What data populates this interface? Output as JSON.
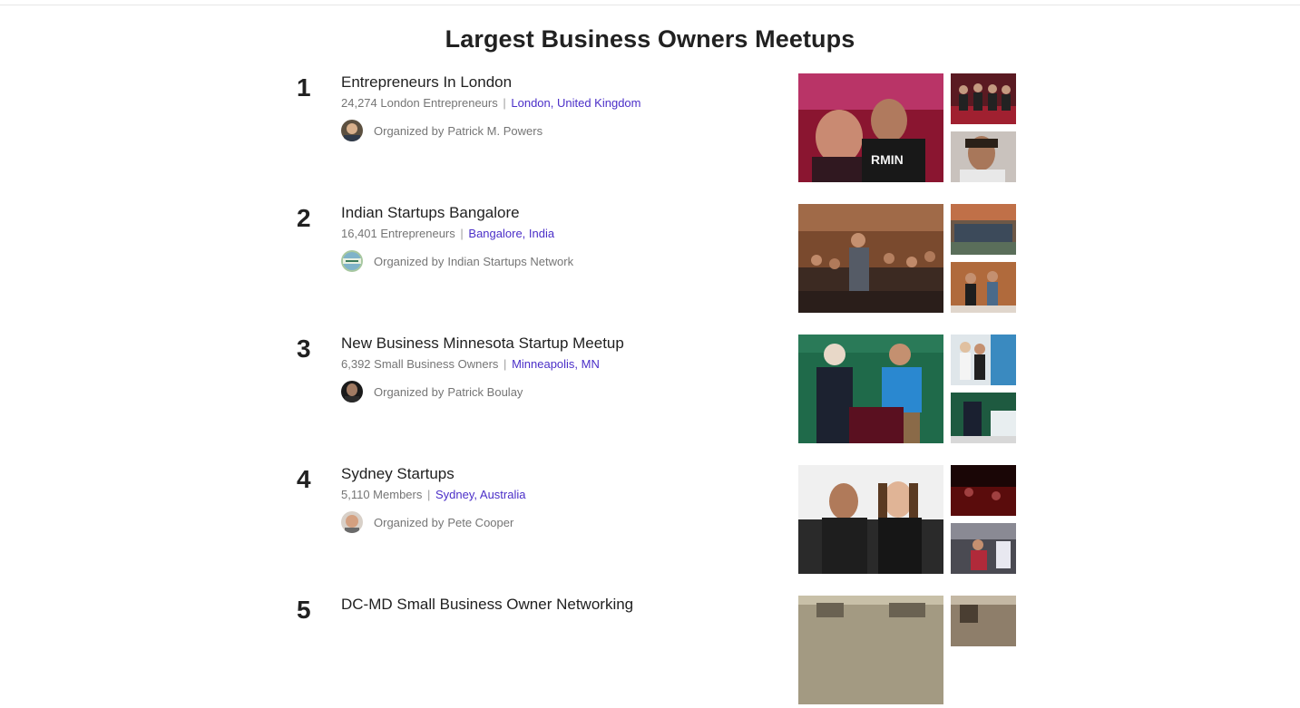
{
  "page": {
    "title": "Largest Business Owners Meetups"
  },
  "organizer_prefix": "Organized by",
  "groups": [
    {
      "rank": "1",
      "name": "Entrepreneurs In London",
      "member_count": "24,274 London Entrepreneurs",
      "separator": "|",
      "location": "London, United Kingdom",
      "organizer": "Patrick M. Powers",
      "photo_colors": {
        "main": "#8a1530",
        "top": "#5a1a22",
        "bottom": "#c9c2bd"
      }
    },
    {
      "rank": "2",
      "name": "Indian Startups Bangalore",
      "member_count": "16,401 Entrepreneurs",
      "separator": "|",
      "location": "Bangalore, India",
      "organizer": "Indian Startups Network",
      "photo_colors": {
        "main": "#7a4a2e",
        "top": "#6d5847",
        "bottom": "#b06a3c"
      }
    },
    {
      "rank": "3",
      "name": "New Business Minnesota Startup Meetup",
      "member_count": "6,392 Small Business Owners",
      "separator": "|",
      "location": "Minneapolis, MN",
      "organizer": "Patrick Boulay",
      "photo_colors": {
        "main": "#1f6a4a",
        "top": "#dfe6ea",
        "bottom": "#1e5a40"
      }
    },
    {
      "rank": "4",
      "name": "Sydney Startups",
      "member_count": "5,110 Members",
      "separator": "|",
      "location": "Sydney, Australia",
      "organizer": "Pete Cooper",
      "photo_colors": {
        "main": "#2a2a2a",
        "top": "#5a0c0c",
        "bottom": "#4a4a52"
      }
    },
    {
      "rank": "5",
      "name": "DC-MD Small Business Owner Networking",
      "photo_colors": {
        "main": "#a39a82",
        "top": "#8e7e6a"
      }
    }
  ],
  "colors": {
    "link": "#4b2fc8",
    "muted_text": "#757575",
    "heading": "#212121"
  }
}
